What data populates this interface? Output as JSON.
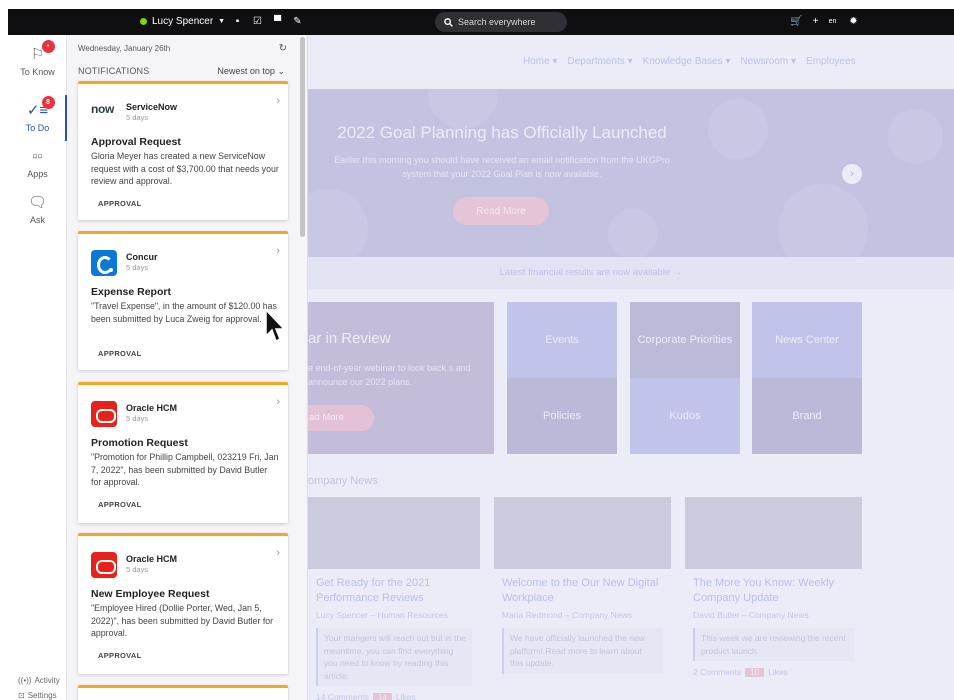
{
  "topbar": {
    "user_name": "Lucy Spencer",
    "search_placeholder": "Search everywhere",
    "icons": [
      "chat-icon",
      "checklist-icon",
      "bookmark-icon",
      "edit-icon",
      "cart-icon",
      "plus-icon",
      "language-icon",
      "settings-icon"
    ],
    "lang_label": "en",
    "status_color": "#7ed321"
  },
  "rail": {
    "items": [
      {
        "label": "To Know",
        "icon": "flag-icon",
        "badge": "•"
      },
      {
        "label": "To Do",
        "icon": "checklist-icon",
        "badge": "8"
      },
      {
        "label": "Apps",
        "icon": "apps-grid-icon"
      },
      {
        "label": "Ask",
        "icon": "chat-bubble-icon"
      }
    ],
    "activity_label": "Activity",
    "settings_label": "Settings"
  },
  "panel": {
    "date": "Wednesday, January 26th",
    "title": "NOTIFICATIONS",
    "sort": "Newest on top",
    "cards": [
      {
        "vendor": "ServiceNow",
        "logo_text": "now",
        "age": "5 days",
        "title": "Approval Request",
        "body": "Gloria Meyer has created a new ServiceNow request with a cost of $3,700.00 that needs your review and approval.",
        "tag": "APPROVAL"
      },
      {
        "vendor": "Concur",
        "age": "5 days",
        "title": "Expense Report",
        "body": "\"Travel Expense\", in the amount of $120.00 has been submitted by Luca Zweig for approval.",
        "tag": "APPROVAL"
      },
      {
        "vendor": "Oracle HCM",
        "age": "5 days",
        "title": "Promotion Request",
        "body": "\"Promotion for Phillip Campbell, 023219 Fri, Jan 7, 2022\", has been submitted by David Butler for approval.",
        "tag": "APPROVAL"
      },
      {
        "vendor": "Oracle HCM",
        "age": "5 days",
        "title": "New Employee Request",
        "body": "\"Employee Hired (Dollie Porter, Wed, Jan 5, 2022)\", has been submitted by David Butler for approval.",
        "tag": "APPROVAL"
      }
    ],
    "accent_color": "#f5a623"
  },
  "site": {
    "nav": [
      "Home",
      "Departments",
      "Knowledge Bases",
      "Newsroom",
      "Employees"
    ],
    "hero": {
      "title": "2022 Goal Planning has Officially Launched",
      "text": "Earlier this morning you should have received an email notification from the UKGPro system that your 2022 Goal Plan is now available.",
      "button": "Read More"
    },
    "ticker": "Latest financial results are now available →",
    "year_review": {
      "title": "ar in Review",
      "text": "e end-of-year webinar to look back s and announce our 2022 plans.",
      "button": "ad More"
    },
    "tiles": [
      "Events",
      "Corporate Priorities",
      "News Center",
      "Policies",
      "Kudos",
      "Brand"
    ],
    "news_heading": "ompany News",
    "news": [
      {
        "title": "Get Ready for the 2021 Performance Reviews",
        "author": "Lucy Spencer",
        "dept": "Human Resources",
        "desc": "Your mangers will reach out but in the meantime, you can find everything you need to know by reading this article.",
        "comments": "14 Comments",
        "likes": "14",
        "likes_label": "Likes"
      },
      {
        "title": "Welcome to the Our New Digital Workplace",
        "author": "Maria Redmond",
        "dept": "Company News",
        "desc": "We have officially launched the new platform! Read more to learn about this update.",
        "comments": "",
        "likes": "",
        "likes_label": ""
      },
      {
        "title": "The More You Know: Weekly Company Update",
        "author": "David Butler",
        "dept": "Company News",
        "desc": "This week we are reviewing the recent product launch.",
        "comments": "2 Comments",
        "likes": "10",
        "likes_label": "Likes"
      }
    ]
  }
}
